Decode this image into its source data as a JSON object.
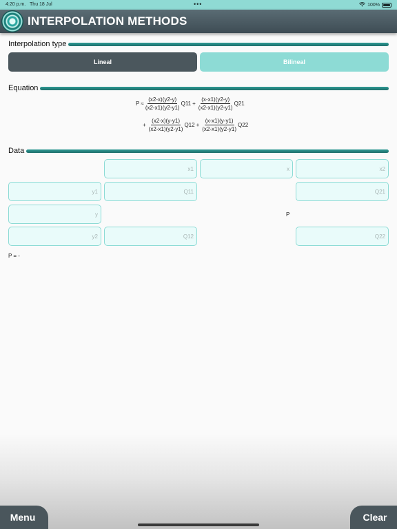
{
  "status_bar": {
    "time": "4:20 p.m.",
    "date": "Thu 18 Jul",
    "dots": "•••",
    "battery": "100%"
  },
  "header": {
    "title": "INTERPOLATION METHODS"
  },
  "interpolation_type": {
    "label": "Interpolation type",
    "options": [
      "Lineal",
      "Bilineal"
    ],
    "selected": "Lineal"
  },
  "equation": {
    "label": "Equation",
    "p_approx": "P ≈",
    "plus": "+",
    "terms": [
      {
        "num": "(x2-x)(y2-y)",
        "den": "(x2-x1)(y2-y1)",
        "q": "Q11"
      },
      {
        "num": "(x-x1)(y2-y)",
        "den": "(x2-x1)(y2-y1)",
        "q": "Q21"
      },
      {
        "num": "(x2-x)(y-y1)",
        "den": "(x2-x1)(y2-y1)",
        "q": "Q12"
      },
      {
        "num": "(x-x1)(y-y1)",
        "den": "(x2-x1)(y2-y1)",
        "q": "Q22"
      }
    ]
  },
  "data": {
    "label": "Data",
    "fields": {
      "x1": "x1",
      "x": "x",
      "x2": "x2",
      "y1": "y1",
      "q11": "Q11",
      "q21": "Q21",
      "y": "y",
      "y2": "y2",
      "q12": "Q12",
      "q22": "Q22"
    },
    "p_label": "P",
    "result": "P = -"
  },
  "footer": {
    "menu_label": "Menu",
    "clear_label": "Clear"
  },
  "colors": {
    "accent": "#2d9a95",
    "header": "#4b575d",
    "field_bg": "#e9fbfa",
    "field_border": "#8ddbd5"
  }
}
